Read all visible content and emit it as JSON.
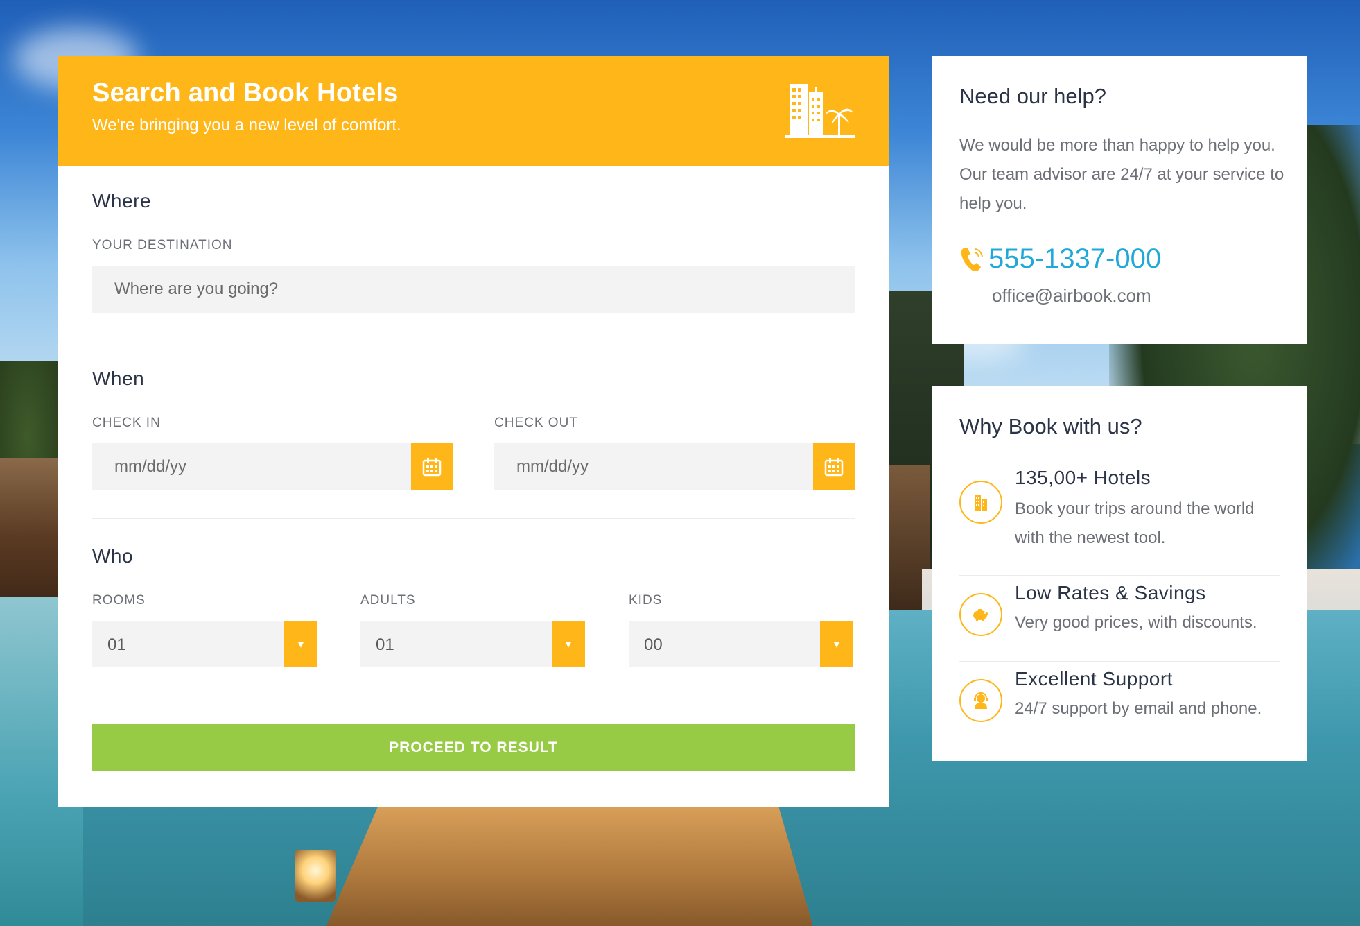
{
  "booking": {
    "title": "Search and Book Hotels",
    "subtitle": "We're bringing you a new level of comfort.",
    "header_icon": "hotel-building-palm-icon",
    "accent_color": "#ffb619",
    "where": {
      "section_label": "Where",
      "destination_label": "YOUR DESTINATION",
      "destination_placeholder": "Where are you going?",
      "destination_value": ""
    },
    "when": {
      "section_label": "When",
      "checkin_label": "CHECK IN",
      "checkin_placeholder": "mm/dd/yy",
      "checkout_label": "CHECK OUT",
      "checkout_placeholder": "mm/dd/yy",
      "calendar_icon": "calendar-icon"
    },
    "who": {
      "section_label": "Who",
      "rooms_label": "ROOMS",
      "rooms_value": "01",
      "adults_label": "ADULTS",
      "adults_value": "01",
      "kids_label": "KIDS",
      "kids_value": "00",
      "arrow_glyph": "▾"
    },
    "proceed_label": "PROCEED TO RESULT",
    "proceed_color": "#98cb45"
  },
  "help": {
    "title": "Need our help?",
    "text": "We would be more than happy to help you. Our team advisor are 24/7 at your service to help you.",
    "phone": "555-1337-000",
    "phone_color": "#1fa8d8",
    "email": "office@airbook.com"
  },
  "why": {
    "title": "Why Book with us?",
    "features": [
      {
        "title": "135,00+ Hotels",
        "desc": "Book your trips around the world with the newest tool.",
        "icon": "hotel-icon"
      },
      {
        "title": "Low Rates & Savings",
        "desc": "Very good prices, with discounts.",
        "icon": "piggy-bank-icon"
      },
      {
        "title": "Excellent Support",
        "desc": "24/7 support by email and phone.",
        "icon": "support-agent-icon"
      }
    ]
  }
}
